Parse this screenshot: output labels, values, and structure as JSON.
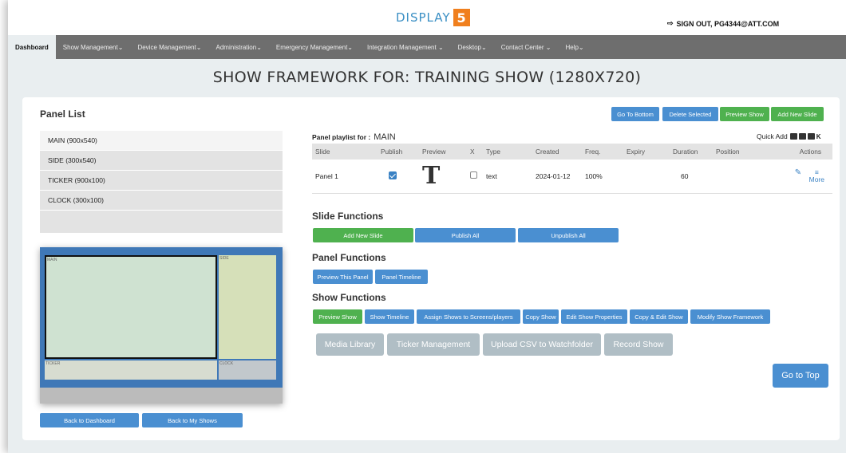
{
  "header": {
    "logo_text": "DISPLAY",
    "logo_mark": "5",
    "signout_icon": "sign-out-icon",
    "signout_label": "SIGN OUT, PG4344@ATT.COM"
  },
  "nav": {
    "items": [
      {
        "label": "Dashboard"
      },
      {
        "label": "Show Management⌄"
      },
      {
        "label": "Device Management⌄"
      },
      {
        "label": "Administration⌄"
      },
      {
        "label": "Emergency Management⌄"
      },
      {
        "label": "Integration Management ⌄"
      },
      {
        "label": "Desktop⌄"
      },
      {
        "label": "Contact Center ⌄"
      },
      {
        "label": "Help⌄"
      }
    ]
  },
  "page_title": "SHOW FRAMEWORK FOR: TRAINING SHOW (1280X720)",
  "panel_list": {
    "title": "Panel List",
    "items": [
      {
        "label": "MAIN  (900x540)"
      },
      {
        "label": "SIDE  (300x540)"
      },
      {
        "label": "TICKER  (900x100)"
      },
      {
        "label": "CLOCK  (300x100)"
      }
    ]
  },
  "layout_preview": {
    "zones": {
      "main": "MAIN",
      "side": "SIDE",
      "ticker": "TICKER",
      "clock": "CLOCK"
    }
  },
  "bottom_buttons": {
    "back_dashboard": "Back to Dashboard",
    "back_shows": "Back to My Shows"
  },
  "top_actions": {
    "go_bottom": "Go To Bottom",
    "delete_selected": "Delete Selected",
    "preview_show": "Preview Show",
    "add_new_slide": "Add New Slide"
  },
  "playlist": {
    "label": "Panel playlist for :",
    "panel_name": "MAIN",
    "quick_add_label": "Quick Add",
    "quick_add_k": "K",
    "columns": [
      "Slide",
      "Publish",
      "Preview",
      "X",
      "Type",
      "Created",
      "Freq.",
      "Expiry",
      "Duration",
      "Position",
      "Actions"
    ],
    "rows": [
      {
        "slide": "Panel 1",
        "preview_glyph": "T",
        "type": "text",
        "created": "2024-01-12",
        "freq": "100%",
        "expiry": "",
        "duration": "60",
        "position": "",
        "more": "More"
      }
    ]
  },
  "slide_functions": {
    "title": "Slide Functions",
    "add_new_slide": "Add New Slide",
    "publish_all": "Publish All",
    "unpublish_all": "Unpublish All"
  },
  "panel_functions": {
    "title": "Panel Functions",
    "preview_panel": "Preview This Panel",
    "panel_timeline": "Panel Timeline"
  },
  "show_functions": {
    "title": "Show Functions",
    "preview_show": "Preview Show",
    "show_timeline": "Show Timeline",
    "assign": "Assign Shows to Screens/players",
    "copy_show": "Copy Show",
    "edit_props": "Edit Show Properties",
    "copy_edit": "Copy & Edit Show",
    "modify_framework": "Modify Show Framework",
    "media_library": "Media Library",
    "ticker_management": "Ticker Management",
    "upload_csv": "Upload CSV to Watchfolder",
    "record_show": "Record Show"
  },
  "go_to_top": "Go to Top",
  "colors": {
    "nav_bg": "#6e6e6e",
    "primary_blue": "#4a8fd1",
    "green": "#4fb14f",
    "logo_orange": "#f07f1d",
    "layout_blue": "#3f78b7",
    "disabled_gray": "#b0bec5"
  }
}
